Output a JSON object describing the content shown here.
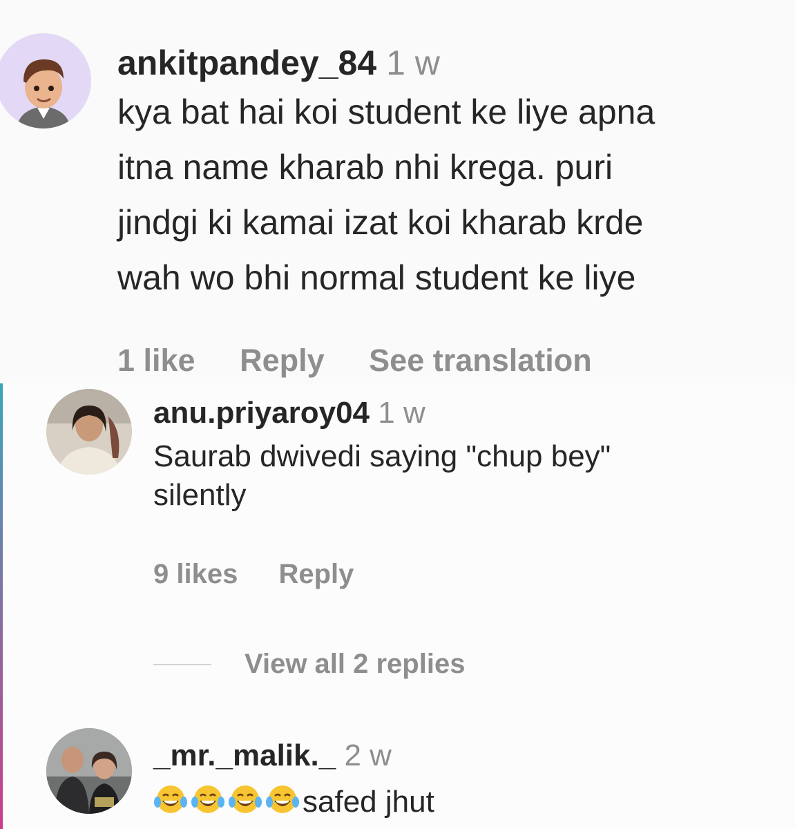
{
  "comments": [
    {
      "username": "ankitpandey_84",
      "time": "1 w",
      "text_lines": [
        "kya bat hai koi student ke liye apna",
        "itna name kharab nhi krega. puri",
        "jindgi ki kamai izat koi kharab krde",
        "wah wo bhi normal student ke liye"
      ],
      "likes": "1 like",
      "reply_label": "Reply",
      "translation_label": "See translation"
    },
    {
      "username": "anu.priyaroy04",
      "time": "1 w",
      "text_lines": [
        "Saurab dwivedi saying \"chup bey\"",
        "silently"
      ],
      "likes": "9 likes",
      "reply_label": "Reply",
      "view_replies_label": "View all 2 replies"
    },
    {
      "username": "_mr._malik._",
      "time": "2 w",
      "emoji_name": "face-with-tears-of-joy-emoji",
      "emoji_count": 4,
      "text": "safed jhut"
    }
  ]
}
